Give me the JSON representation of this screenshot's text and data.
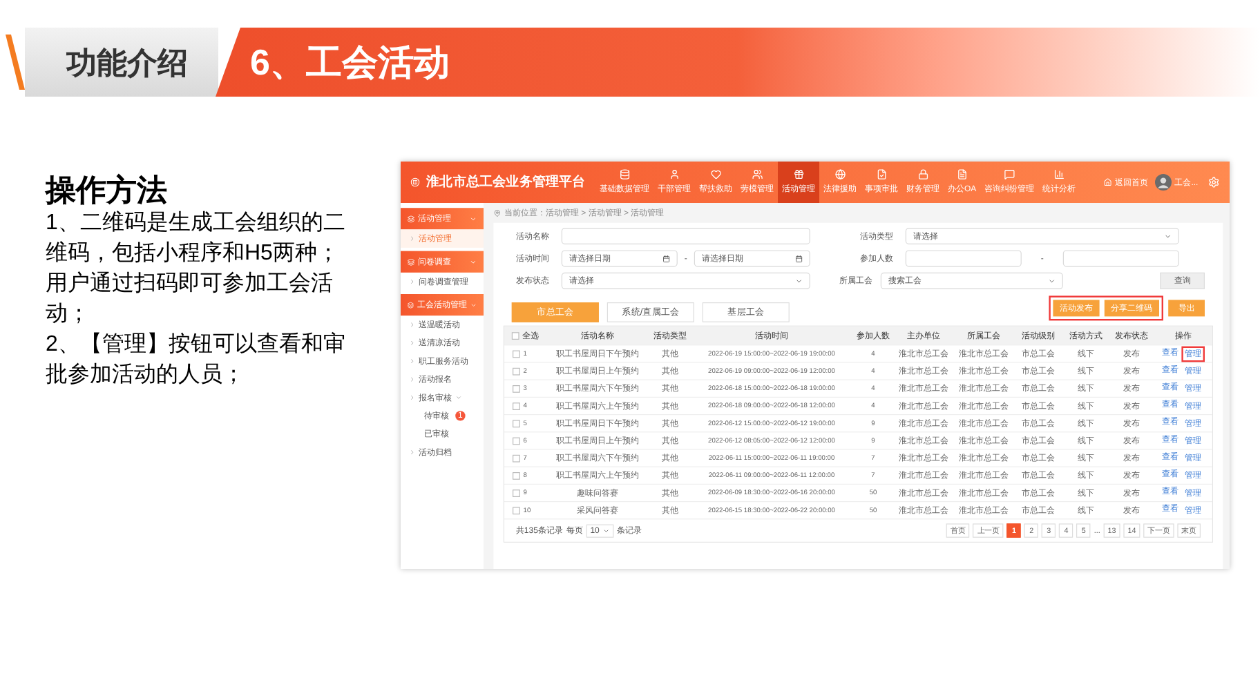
{
  "slide": {
    "section": "功能介绍",
    "title": "6、工会活动",
    "heading": "操作方法",
    "paragraphs": [
      "1、二维码是生成工会组织的二维码，包括小程序和H5两种；用户通过扫码即可参加工会活动；",
      "2、【管理】按钮可以查看和审批参加活动的人员；"
    ]
  },
  "app": {
    "title": "淮北市总工会业务管理平台",
    "nav": [
      {
        "label": "基础数据管理",
        "selected": false
      },
      {
        "label": "干部管理",
        "selected": false
      },
      {
        "label": "帮扶救助",
        "selected": false
      },
      {
        "label": "劳模管理",
        "selected": false
      },
      {
        "label": "活动管理",
        "selected": true
      },
      {
        "label": "法律援助",
        "selected": false
      },
      {
        "label": "事项审批",
        "selected": false
      },
      {
        "label": "财务管理",
        "selected": false
      },
      {
        "label": "办公OA",
        "selected": false
      },
      {
        "label": "咨询纠纷管理",
        "selected": false
      },
      {
        "label": "统计分析",
        "selected": false
      }
    ],
    "home_link": "返回首页",
    "user_name": "工会...",
    "sidebar": [
      {
        "label": "活动管理",
        "expanded": true,
        "children": [
          {
            "label": "活动管理",
            "selected": true
          }
        ]
      },
      {
        "label": "问卷调查",
        "expanded": true,
        "children": [
          {
            "label": "问卷调查管理",
            "selected": false
          }
        ]
      },
      {
        "label": "工会活动管理",
        "expanded": true,
        "children": [
          {
            "label": "送温暖活动",
            "selected": false
          },
          {
            "label": "送清凉活动",
            "selected": false
          },
          {
            "label": "职工服务活动",
            "selected": false
          },
          {
            "label": "活动报名",
            "selected": false
          },
          {
            "label": "报名审核",
            "selected": false,
            "expanded": true,
            "children": [
              {
                "label": "待审核",
                "selected": false,
                "badge": "1"
              },
              {
                "label": "已审核",
                "selected": false
              }
            ]
          },
          {
            "label": "活动归档",
            "selected": false
          }
        ]
      }
    ],
    "breadcrumb": "当前位置：活动管理 > 活动管理 > 活动管理",
    "form": {
      "name_label": "活动名称",
      "type_label": "活动类型",
      "type_value": "请选择",
      "time_label": "活动时间",
      "start_placeholder": "请选择日期",
      "end_placeholder": "请选择日期",
      "count_label": "参加人数",
      "status_label": "发布状态",
      "status_value": "请选择",
      "union_label": "所属工会",
      "union_placeholder": "搜索工会",
      "range_sep": "-",
      "search_button": "查询"
    },
    "tabs": [
      {
        "label": "市总工会",
        "selected": true
      },
      {
        "label": "系统/直属工会",
        "selected": false
      },
      {
        "label": "基层工会",
        "selected": false
      }
    ],
    "highlighted_buttons": [
      "活动发布",
      "分享二维码"
    ],
    "buttons": [
      "导出"
    ],
    "table": {
      "select_all_checked": false,
      "columns": [
        "全选",
        "活动名称",
        "活动类型",
        "活动时间",
        "参加人数",
        "主办单位",
        "所属工会",
        "活动级别",
        "活动方式",
        "发布状态",
        "操作"
      ],
      "rows": [
        {
          "index": "1",
          "checked": false,
          "name": "职工书屋周日下午预约",
          "type": "其他",
          "time": "2022-06-19 15:00:00~2022-06-19 19:00:00",
          "count": "4",
          "host": "淮北市总工会",
          "union": "淮北市总工会",
          "level": "市总工会",
          "mode": "线下",
          "status": "发布",
          "view": "查看",
          "manage": "管理",
          "highlighted": true
        },
        {
          "index": "2",
          "checked": false,
          "name": "职工书屋周日上午预约",
          "type": "其他",
          "time": "2022-06-19 09:00:00~2022-06-19 12:00:00",
          "count": "4",
          "host": "淮北市总工会",
          "union": "淮北市总工会",
          "level": "市总工会",
          "mode": "线下",
          "status": "发布",
          "view": "查看",
          "manage": "管理",
          "highlighted": false
        },
        {
          "index": "3",
          "checked": false,
          "name": "职工书屋周六下午预约",
          "type": "其他",
          "time": "2022-06-18 15:00:00~2022-06-18 19:00:00",
          "count": "4",
          "host": "淮北市总工会",
          "union": "淮北市总工会",
          "level": "市总工会",
          "mode": "线下",
          "status": "发布",
          "view": "查看",
          "manage": "管理",
          "highlighted": false
        },
        {
          "index": "4",
          "checked": false,
          "name": "职工书屋周六上午预约",
          "type": "其他",
          "time": "2022-06-18 09:00:00~2022-06-18 12:00:00",
          "count": "4",
          "host": "淮北市总工会",
          "union": "淮北市总工会",
          "level": "市总工会",
          "mode": "线下",
          "status": "发布",
          "view": "查看",
          "manage": "管理",
          "highlighted": false
        },
        {
          "index": "5",
          "checked": false,
          "name": "职工书屋周日下午预约",
          "type": "其他",
          "time": "2022-06-12 15:00:00~2022-06-12 19:00:00",
          "count": "9",
          "host": "淮北市总工会",
          "union": "淮北市总工会",
          "level": "市总工会",
          "mode": "线下",
          "status": "发布",
          "view": "查看",
          "manage": "管理",
          "highlighted": false
        },
        {
          "index": "6",
          "checked": false,
          "name": "职工书屋周日上午预约",
          "type": "其他",
          "time": "2022-06-12 08:05:00~2022-06-12 12:00:00",
          "count": "9",
          "host": "淮北市总工会",
          "union": "淮北市总工会",
          "level": "市总工会",
          "mode": "线下",
          "status": "发布",
          "view": "查看",
          "manage": "管理",
          "highlighted": false
        },
        {
          "index": "7",
          "checked": false,
          "name": "职工书屋周六下午预约",
          "type": "其他",
          "time": "2022-06-11 15:00:00~2022-06-11 19:00:00",
          "count": "7",
          "host": "淮北市总工会",
          "union": "淮北市总工会",
          "level": "市总工会",
          "mode": "线下",
          "status": "发布",
          "view": "查看",
          "manage": "管理",
          "highlighted": false
        },
        {
          "index": "8",
          "checked": false,
          "name": "职工书屋周六上午预约",
          "type": "其他",
          "time": "2022-06-11 09:00:00~2022-06-11 12:00:00",
          "count": "7",
          "host": "淮北市总工会",
          "union": "淮北市总工会",
          "level": "市总工会",
          "mode": "线下",
          "status": "发布",
          "view": "查看",
          "manage": "管理",
          "highlighted": false
        },
        {
          "index": "9",
          "checked": false,
          "name": "趣味问答赛",
          "type": "其他",
          "time": "2022-06-09 18:30:00~2022-06-16 20:00:00",
          "count": "50",
          "host": "淮北市总工会",
          "union": "淮北市总工会",
          "level": "市总工会",
          "mode": "线下",
          "status": "发布",
          "view": "查看",
          "manage": "管理",
          "highlighted": false
        },
        {
          "index": "10",
          "checked": false,
          "name": "采风问答赛",
          "type": "其他",
          "time": "2022-06-15 18:30:00~2022-06-22 20:00:00",
          "count": "50",
          "host": "淮北市总工会",
          "union": "淮北市总工会",
          "level": "市总工会",
          "mode": "线下",
          "status": "发布",
          "view": "查看",
          "manage": "管理",
          "highlighted": false
        }
      ]
    },
    "footer": {
      "total": "共135条记录",
      "per_page_label": "每页",
      "per_page": "10",
      "per_page_suffix": "条记录"
    },
    "pagination": [
      {
        "label": "首页",
        "selected": false
      },
      {
        "label": "上一页",
        "selected": false
      },
      {
        "label": "1",
        "selected": true
      },
      {
        "label": "2",
        "selected": false
      },
      {
        "label": "3",
        "selected": false
      },
      {
        "label": "4",
        "selected": false
      },
      {
        "label": "5",
        "selected": false
      },
      {
        "label": "...",
        "kind": "gap"
      },
      {
        "label": "13",
        "selected": false
      },
      {
        "label": "14",
        "selected": false
      },
      {
        "label": "下一页",
        "selected": false
      },
      {
        "label": "末页",
        "selected": false
      }
    ]
  }
}
